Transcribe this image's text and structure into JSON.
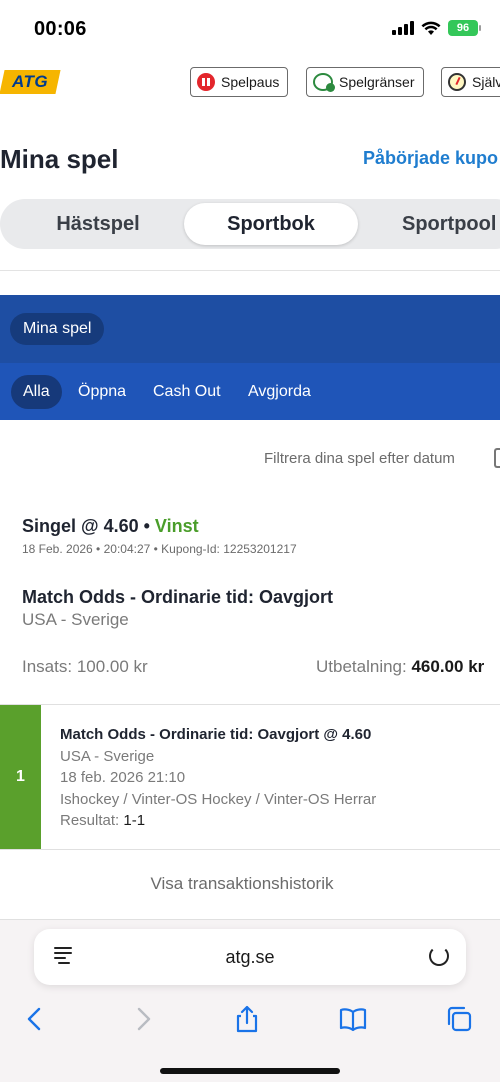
{
  "status_bar": {
    "time": "00:06",
    "battery": "96"
  },
  "top_bar": {
    "logo": "ATG",
    "buttons": [
      "Spelpaus",
      "Spelgränser",
      "Själv"
    ]
  },
  "header": {
    "title": "Mina spel",
    "started_link": "Påbörjade kupo"
  },
  "segments": [
    "Hästspel",
    "Sportbok",
    "Sportpool"
  ],
  "sub_header": {
    "pill": "Mina spel"
  },
  "filter_tabs": [
    "Alla",
    "Öppna",
    "Cash Out",
    "Avgjorda"
  ],
  "filter_date": "Filtrera dina spel efter datum",
  "bet": {
    "title": "Singel @ 4.60",
    "separator": " • ",
    "status": "Vinst",
    "meta": "18 Feb. 2026 • 20:04:27 • Kupong-Id: 12253201217",
    "market": "Match Odds - Ordinarie tid: Oavgjort",
    "match": "USA - Sverige",
    "stake_label": "Insats:",
    "stake_value": "100.00 kr",
    "payout_label": "Utbetalning:",
    "payout_value": "460.00 kr"
  },
  "selection": {
    "number": "1",
    "title": "Match Odds - Ordinarie tid: Oavgjort @ 4.60",
    "match": "USA - Sverige",
    "datetime": "18 feb. 2026 21:10",
    "category": "Ishockey / Vinter-OS Hockey / Vinter-OS Herrar",
    "result_label": "Resultat:",
    "result_value": "1-1"
  },
  "history_link": "Visa transaktionshistorik",
  "browser": {
    "url": "atg.se"
  }
}
